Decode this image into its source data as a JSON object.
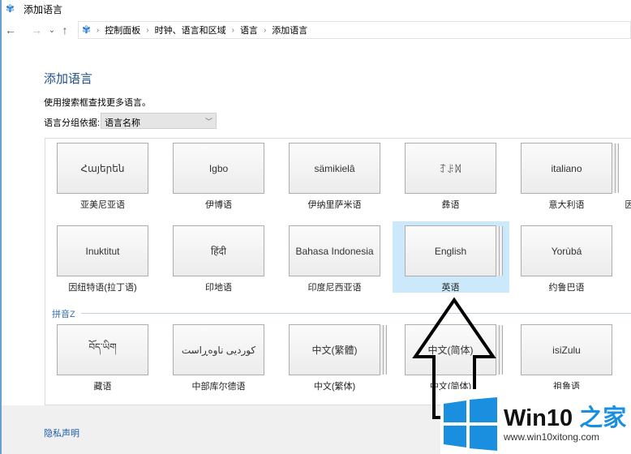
{
  "window": {
    "title": "添加语言",
    "icon": "control-panel-icon"
  },
  "nav": {
    "back": "←",
    "forward": "→",
    "recent": "⌄",
    "up": "↑",
    "breadcrumb": [
      "控制面板",
      "时钟、语言和区域",
      "语言",
      "添加语言"
    ]
  },
  "main": {
    "heading": "添加语言",
    "hint": "使用搜索框查找更多语言。",
    "group_label": "语言分组依据:",
    "group_value": "语言名称",
    "section_z": "拼音Z",
    "languages": [
      {
        "native": "Հայերեն",
        "name": "亚美尼亚语"
      },
      {
        "native": "Igbo",
        "name": "伊博语"
      },
      {
        "native": "sämikielâ",
        "name": "伊纳里萨米语"
      },
      {
        "native": "ꆈꌠꉙ",
        "name": "彝语"
      },
      {
        "native": "italiano",
        "name": "意大利语",
        "stacked": true
      },
      {
        "native": "Inuktitut",
        "name": "因纽特语(拉丁语)"
      },
      {
        "native": "हिंदी",
        "name": "印地语"
      },
      {
        "native": "Bahasa Indonesia",
        "name": "印度尼西亚语"
      },
      {
        "native": "English",
        "name": "英语",
        "stacked": true,
        "selected": true
      },
      {
        "native": "Yorùbá",
        "name": "约鲁巴语"
      },
      {
        "native": "བོད་ཡིག",
        "name": "藏语"
      },
      {
        "native": "کوردیی ناوەڕاست",
        "name": "中部库尔德语"
      },
      {
        "native": "中文(繁體)",
        "name": "中文(繁体)",
        "stacked": true
      },
      {
        "native": "中文(简体)",
        "name": "中文(简体)",
        "stacked": true
      },
      {
        "native": "isiZulu",
        "name": "祖鲁语"
      }
    ],
    "partial_label": "因"
  },
  "footer": {
    "privacy": "隐私声明"
  },
  "watermark": {
    "brand": "Win10",
    "brand_accent": "之家",
    "url": "www.win10xitong.com",
    "colors": {
      "accent": "#1a8fe0"
    }
  },
  "colors": {
    "selection": "#cce8fb",
    "heading": "#1e4e8c"
  }
}
